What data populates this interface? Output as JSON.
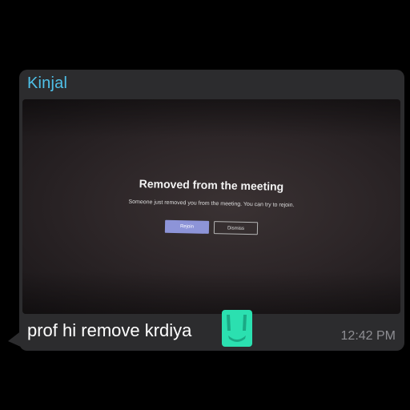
{
  "chat": {
    "sender": "Kinjal",
    "caption": "prof hi remove krdiya",
    "emoji": "laughing-emoji",
    "timestamp": "12:42 PM",
    "sender_color": "#4fc1e9",
    "bubble_color": "#2c2c2e"
  },
  "photo": {
    "dialog": {
      "title": "Removed from the meeting",
      "message": "Someone just removed you from the meeting. You can try to rejoin.",
      "rejoin_label": "Rejoin",
      "dismiss_label": "Dismiss",
      "rejoin_color": "#8d94d8"
    }
  }
}
